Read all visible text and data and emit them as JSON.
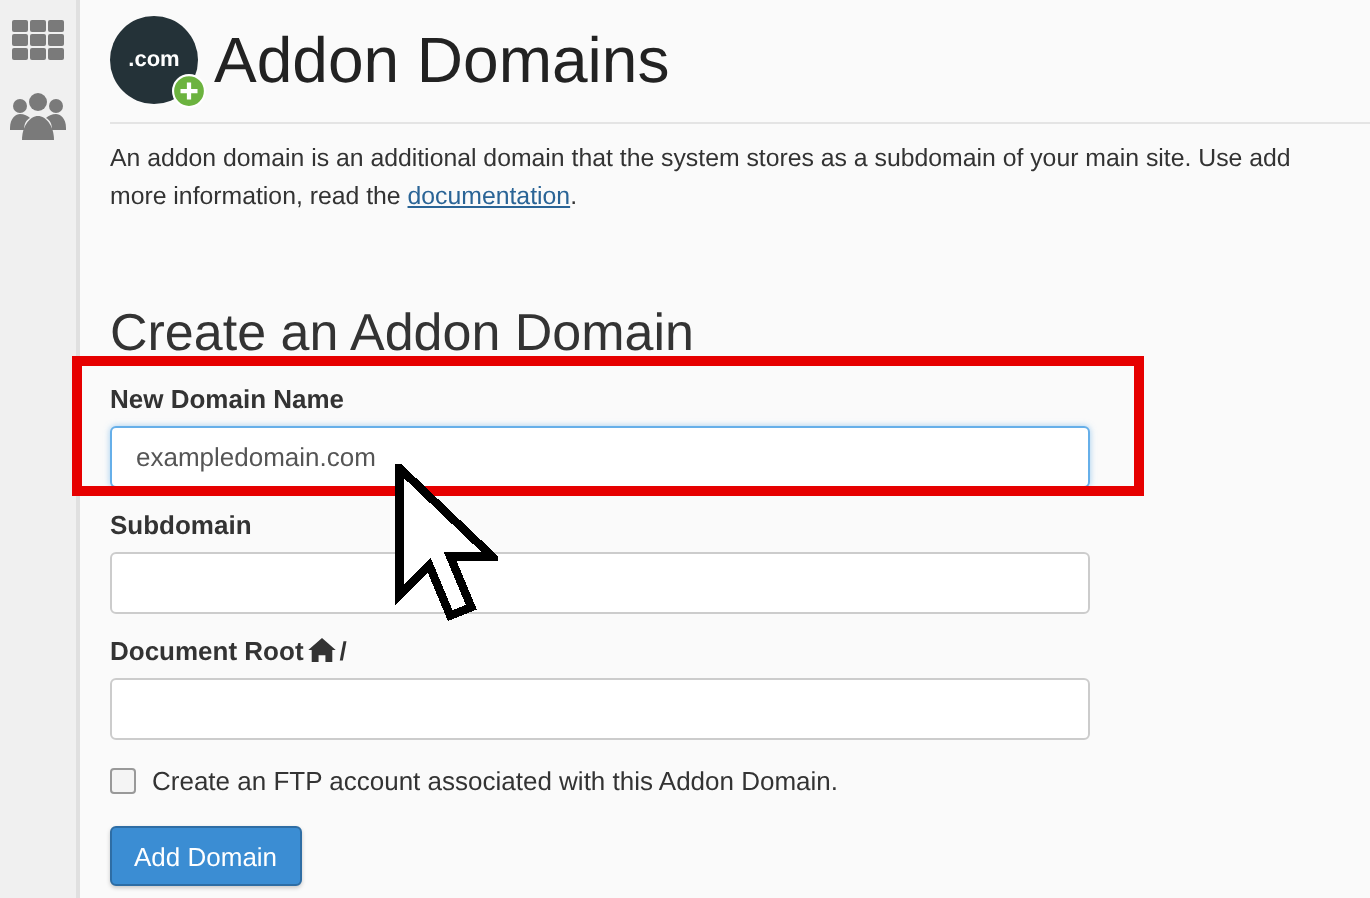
{
  "header": {
    "logo_text": ".com",
    "title": "Addon Domains"
  },
  "description": {
    "line_1": "An addon domain is an additional domain that the system stores as a subdomain of your main site. Use add",
    "line_2_before": "more information, read the ",
    "link": "documentation",
    "line_2_after": "."
  },
  "section_title": "Create an Addon Domain",
  "fields": [
    {
      "label": "New Domain Name",
      "value": "exampledomain.com",
      "focused": true
    },
    {
      "label": "Subdomain",
      "focused": false
    },
    {
      "label": "Document Root",
      "focused": false,
      "home_icon": true,
      "suffix": "/"
    }
  ],
  "ftp_checkbox": {
    "label": "Create an FTP account associated with this Addon Domain.",
    "checked": false
  },
  "submit_button": "Add Domain"
}
